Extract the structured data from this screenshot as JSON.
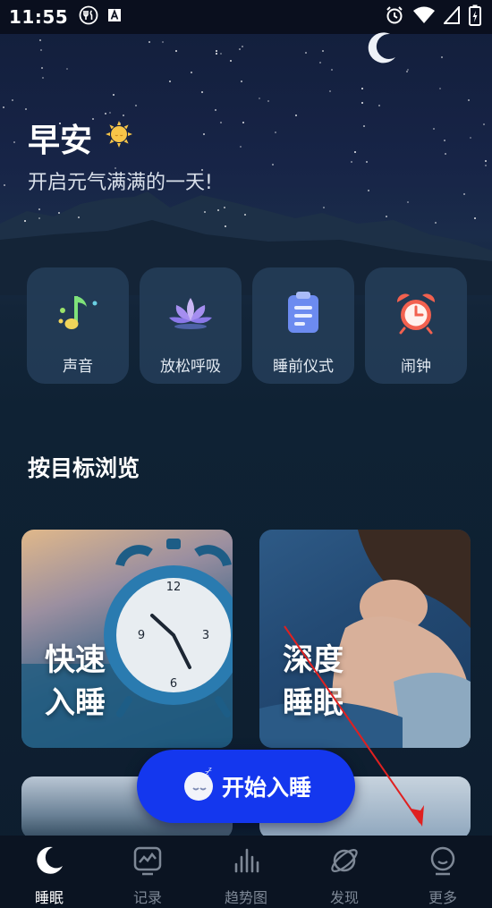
{
  "status_bar": {
    "time": "11:55",
    "left_icons": [
      "dining-icon",
      "font-a-icon"
    ],
    "right_icons": [
      "alarm-icon",
      "wifi-icon",
      "signal-icon",
      "battery-charging-icon"
    ]
  },
  "header": {
    "greeting": "早安",
    "greeting_icon": "sun-icon",
    "subtitle": "开启元气满满的一天!"
  },
  "quick_actions": [
    {
      "label": "声音",
      "icon": "music-note-icon"
    },
    {
      "label": "放松呼吸",
      "icon": "lotus-icon"
    },
    {
      "label": "睡前仪式",
      "icon": "clipboard-icon"
    },
    {
      "label": "闹钟",
      "icon": "alarm-clock-icon"
    }
  ],
  "browse": {
    "title": "按目标浏览",
    "cards": [
      {
        "line1": "快速",
        "line2": "入睡"
      },
      {
        "line1": "深度",
        "line2": "睡眠"
      }
    ]
  },
  "start_button": {
    "label": "开始入睡"
  },
  "tabs": [
    {
      "label": "睡眠",
      "icon": "moon-icon",
      "active": true
    },
    {
      "label": "记录",
      "icon": "chart-record-icon",
      "active": false
    },
    {
      "label": "趋势图",
      "icon": "bar-chart-icon",
      "active": false
    },
    {
      "label": "发现",
      "icon": "planet-icon",
      "active": false
    },
    {
      "label": "更多",
      "icon": "smile-face-icon",
      "active": false
    }
  ],
  "colors": {
    "accent": "#1437ee",
    "card_bg": "#26405c",
    "tab_inactive": "#7e8896",
    "annotation_arrow": "#e02020"
  }
}
